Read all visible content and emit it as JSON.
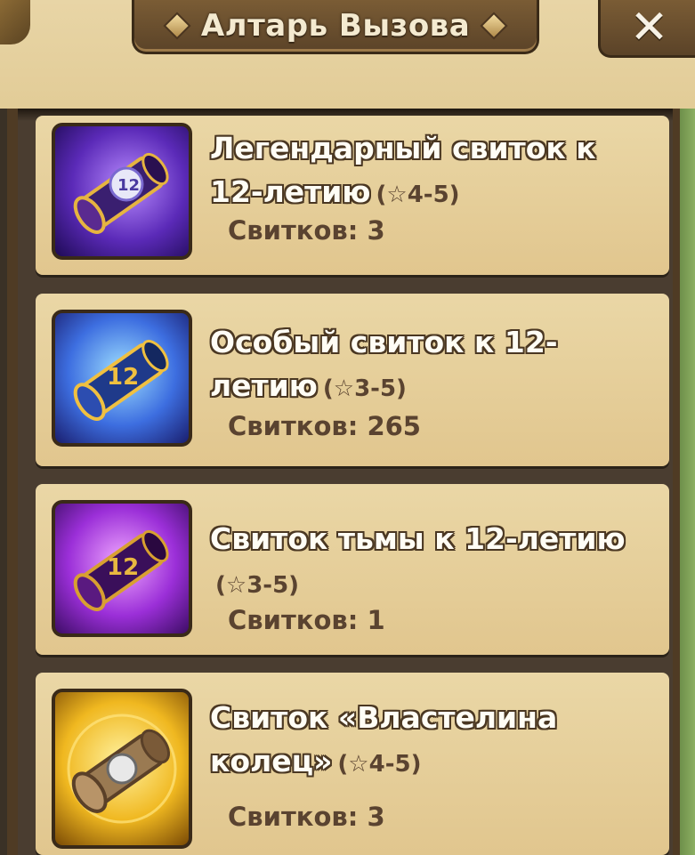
{
  "header": {
    "title": "Алтарь Вызова",
    "close_label": "✕"
  },
  "scrolls": [
    {
      "title_main": "Легендарный свиток к 12-летию",
      "stars": "(☆4-5)",
      "count_label": "Свитков:",
      "count": "3",
      "icon": "legendary-scroll-icon"
    },
    {
      "title_main": "Особый свиток к 12-летию",
      "stars": "(☆3-5)",
      "count_label": "Свитков:",
      "count": "265",
      "icon": "special-scroll-icon"
    },
    {
      "title_main": "Свиток тьмы к 12-летию",
      "stars": "(☆3-5)",
      "count_label": "Свитков:",
      "count": "1",
      "icon": "dark-scroll-icon"
    },
    {
      "title_main": "Свиток «Властелина колец»",
      "stars": "(☆4-5)",
      "count_label": "Свитков:",
      "count": "3",
      "icon": "lotr-scroll-icon"
    }
  ],
  "colors": {
    "panel": "#e2cc97",
    "frame": "#4f3b24",
    "card": "#e6d09c",
    "text_outline": "#4a3722",
    "count_text": "#5a4330"
  }
}
